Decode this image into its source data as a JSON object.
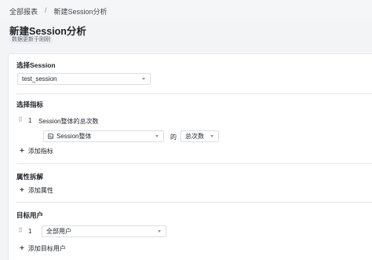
{
  "breadcrumb": {
    "root": "全部报表",
    "separator": "/",
    "current": "新建Session分析"
  },
  "page": {
    "title": "新建Session分析",
    "update_status": "数据更新于刚刚"
  },
  "session_section": {
    "title": "选择Session",
    "selected": "test_session"
  },
  "metric_section": {
    "title": "选择指标",
    "rows": [
      {
        "index": "1",
        "name": "Session整体的总次数",
        "entity": "Session整体",
        "connector": "的",
        "measure": "总次数"
      }
    ],
    "add_label": "添加指标"
  },
  "breakdown_section": {
    "title": "属性拆解",
    "add_label": "添加属性"
  },
  "audience_section": {
    "title": "目标用户",
    "rows": [
      {
        "index": "1",
        "selected": "全部用户"
      }
    ],
    "add_label": "添加目标用户"
  },
  "icons": {
    "drag": "drag-handle-icon",
    "caret": "chevron-down-icon",
    "plus": "plus-icon",
    "metric": "metric-icon"
  }
}
